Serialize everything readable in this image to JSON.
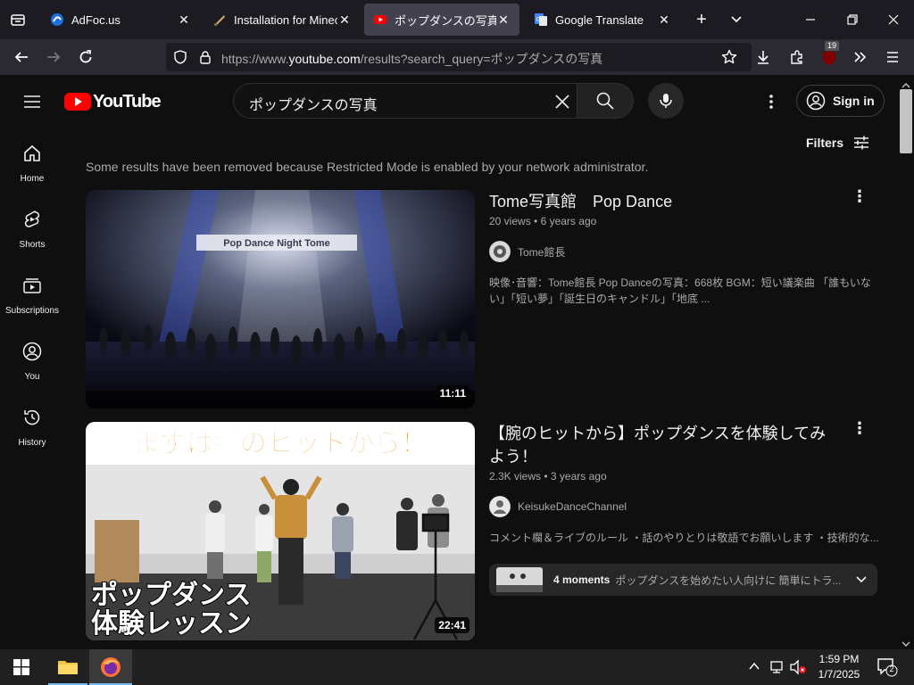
{
  "browser": {
    "tabs": [
      {
        "title": "AdFoc.us",
        "active": false
      },
      {
        "title": "Installation for Minecraft",
        "active": false
      },
      {
        "title": "ポップダンスの写真 - YouTube",
        "active": true
      },
      {
        "title": "Google Translate",
        "active": false
      }
    ],
    "url_prefix": "https://www.",
    "url_domain": "youtube.com",
    "url_path": "/results?search_query=ポップダンスの写真",
    "extension_badge": "19"
  },
  "youtube": {
    "logo_text": "YouTube",
    "search_query": "ポップダンスの写真",
    "sign_in_label": "Sign in",
    "filters_label": "Filters",
    "restricted_notice": "Some results have been removed because Restricted Mode is enabled by your network administrator.",
    "sidebar": [
      {
        "label": "Home",
        "icon": "home-icon"
      },
      {
        "label": "Shorts",
        "icon": "shorts-icon"
      },
      {
        "label": "Subscriptions",
        "icon": "subscriptions-icon"
      },
      {
        "label": "You",
        "icon": "you-icon"
      },
      {
        "label": "History",
        "icon": "history-icon"
      }
    ],
    "results": [
      {
        "title": "Tome写真館　Pop Dance",
        "views": "20 views",
        "age": "6 years ago",
        "channel": "Tome館長",
        "duration": "11:11",
        "description_line1": "映像･音響：Tome館長 Pop Danceの写真：668枚 BGM：短い議楽曲 「誰もいな",
        "description_line2": "い」「短い夢」「誕生日のキャンドル」「地底 ...",
        "banner_text": "Pop Dance Night Tome"
      },
      {
        "title": "【腕のヒットから】ポップダンスを体験してみよう！",
        "views": "2.3K views",
        "age": "3 years ago",
        "channel": "KeisukeDanceChannel",
        "duration": "22:41",
        "description": "コメント欄＆ライブのルール ・話のやりとりは敬語でお願いします ・技術的な...",
        "thumb_top_text": "まずは腕のヒットから！",
        "thumb_bottom_line1": "ポップダンス",
        "thumb_bottom_line2": "体験レッスン",
        "moments_label": "4 moments",
        "moments_text": "ポップダンスを始めたい人向けに 簡単にトラ..."
      }
    ]
  },
  "taskbar": {
    "time": "1:59 PM",
    "date": "1/7/2025",
    "notification_count": "2"
  }
}
